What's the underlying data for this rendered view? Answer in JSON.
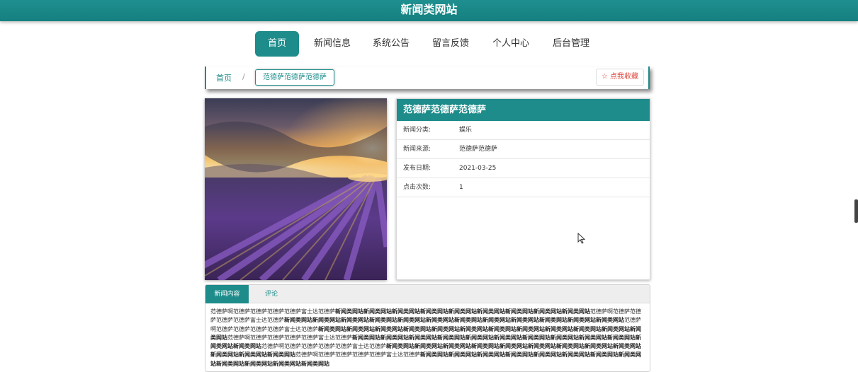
{
  "site": {
    "title": "新闻类网站"
  },
  "nav": {
    "items": [
      {
        "label": "首页",
        "active": true
      },
      {
        "label": "新闻信息"
      },
      {
        "label": "系统公告"
      },
      {
        "label": "留言反馈"
      },
      {
        "label": "个人中心"
      },
      {
        "label": "后台管理"
      }
    ]
  },
  "breadcrumb": {
    "home": "首页",
    "separator": "/",
    "current": "范德萨范德萨范德萨"
  },
  "favorite": {
    "icon": "star-outline-icon",
    "label": "点我收藏"
  },
  "news": {
    "title": "范德萨范德萨范德萨",
    "fields": [
      {
        "key": "新闻分类:",
        "value": "娱乐"
      },
      {
        "key": "新闻来源:",
        "value": "范德萨范德萨"
      },
      {
        "key": "发布日期:",
        "value": "2021-03-25"
      },
      {
        "key": "点击次数:",
        "value": "1"
      }
    ]
  },
  "tabs": {
    "content": "新闻内容",
    "comments": "评论"
  },
  "article": {
    "lead": "范德萨啊范德萨范德萨范德萨范德萨富士达范德萨",
    "bold": "新闻类网站新闻类网站新闻类网站新闻类网站新闻类网站新闻类网站新闻类网站新闻类网站新闻类网站",
    "repeat_lead": "范德萨啊范德萨范德萨范德萨范德萨富士达范德萨",
    "tail": "新闻类网站新闻类网站新闻类网站新闻类网站新闻类网站新闻类网站新闻类网站新闻类网站新闻类网站新闻类网站新闻类网站新闻类网站"
  },
  "colors": {
    "accent": "#1d8c8a",
    "favorite": "#e0463c"
  }
}
